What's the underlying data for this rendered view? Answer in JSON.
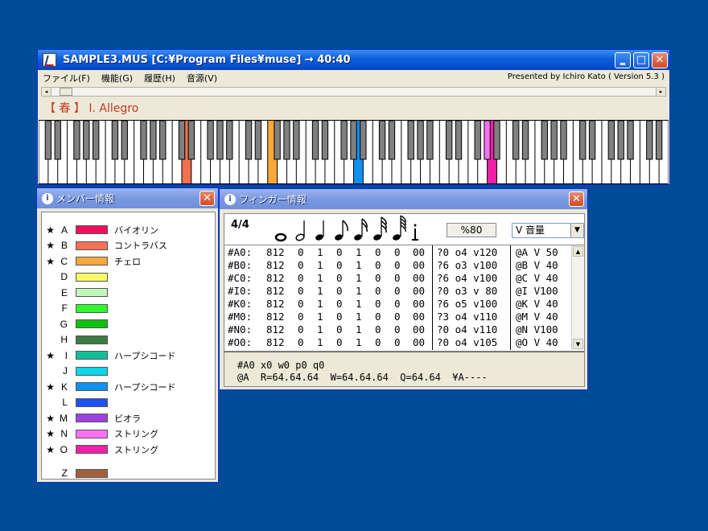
{
  "main_window": {
    "title": "SAMPLE3.MUS [C:¥Program Files¥muse] → 40:40",
    "menu": [
      "ファイル(F)",
      "機能(G)",
      "履歴(H)",
      "音源(V)"
    ],
    "presented": "Presented by Ichiro Kato ( Version 5.3 )",
    "piece_title": "【 春 】 Ⅰ. Allegro"
  },
  "keyboard": {
    "highlight_colors": {
      "salmon": "#f07050",
      "orange": "#f8a838",
      "blue": "#1090f0",
      "pink": "#f870f0",
      "magenta": "#f020a8"
    }
  },
  "member_window": {
    "title": "メンバー情報",
    "members": [
      {
        "star": "★",
        "letter": "A",
        "color": "#f0105a",
        "name": "バイオリン"
      },
      {
        "star": "★",
        "letter": "B",
        "color": "#f87058",
        "name": "コントラバス"
      },
      {
        "star": "★",
        "letter": "C",
        "color": "#f8a840",
        "name": "チェロ"
      },
      {
        "star": "",
        "letter": "D",
        "color": "#f8f868",
        "name": ""
      },
      {
        "star": "",
        "letter": "E",
        "color": "#c0f8b8",
        "name": ""
      },
      {
        "star": "",
        "letter": "F",
        "color": "#30f830",
        "name": ""
      },
      {
        "star": "",
        "letter": "G",
        "color": "#10c010",
        "name": ""
      },
      {
        "star": "",
        "letter": "H",
        "color": "#3c7c40",
        "name": ""
      },
      {
        "star": "★",
        "letter": "I",
        "color": "#10c098",
        "name": "ハープシコード"
      },
      {
        "star": "",
        "letter": "J",
        "color": "#08d8e8",
        "name": ""
      },
      {
        "star": "★",
        "letter": "K",
        "color": "#1090f0",
        "name": "ハープシコード"
      },
      {
        "star": "",
        "letter": "L",
        "color": "#2050f0",
        "name": ""
      },
      {
        "star": "★",
        "letter": "M",
        "color": "#a040e0",
        "name": "ビオラ"
      },
      {
        "star": "★",
        "letter": "N",
        "color": "#f870f0",
        "name": "ストリング"
      },
      {
        "star": "★",
        "letter": "O",
        "color": "#f020a8",
        "name": "ストリング"
      },
      {
        "star": "",
        "letter": "Z",
        "color": "#a06040",
        "name": ""
      }
    ]
  },
  "finger_window": {
    "title": "フィンガー情報",
    "meter": "4/4",
    "percent": "%80",
    "volume_select": "V 音量",
    "rows": [
      {
        "ch": "#A0:",
        "v1": "812",
        "n": [
          "0",
          "1",
          "0",
          "1",
          "0",
          "0"
        ],
        "code": "00",
        "p": "?0 o4 v120",
        "at": "@A V 50"
      },
      {
        "ch": "#B0:",
        "v1": "812",
        "n": [
          "0",
          "1",
          "0",
          "1",
          "0",
          "0"
        ],
        "code": "00",
        "p": "?6 o3 v100",
        "at": "@B V 40"
      },
      {
        "ch": "#C0:",
        "v1": "812",
        "n": [
          "0",
          "1",
          "0",
          "1",
          "0",
          "0"
        ],
        "code": "00",
        "p": "?6 o4 v100",
        "at": "@C V 40"
      },
      {
        "ch": "#I0:",
        "v1": "812",
        "n": [
          "0",
          "1",
          "0",
          "1",
          "0",
          "0"
        ],
        "code": "00",
        "p": "?0 o3 v 80",
        "at": "@I V100"
      },
      {
        "ch": "#K0:",
        "v1": "812",
        "n": [
          "0",
          "1",
          "0",
          "1",
          "0",
          "0"
        ],
        "code": "00",
        "p": "?6 o5 v100",
        "at": "@K V 40"
      },
      {
        "ch": "#M0:",
        "v1": "812",
        "n": [
          "0",
          "1",
          "0",
          "1",
          "0",
          "0"
        ],
        "code": "00",
        "p": "?3 o4 v110",
        "at": "@M V 40"
      },
      {
        "ch": "#N0:",
        "v1": "812",
        "n": [
          "0",
          "1",
          "0",
          "1",
          "0",
          "0"
        ],
        "code": "00",
        "p": "?0 o4 v110",
        "at": "@N V100"
      },
      {
        "ch": "#O0:",
        "v1": "812",
        "n": [
          "0",
          "1",
          "0",
          "1",
          "0",
          "0"
        ],
        "code": "00",
        "p": "?0 o4 v105",
        "at": "@O V 40"
      }
    ],
    "footer_line1": "#A0 x0 w0 p0 q0",
    "footer_line2": "@A  R=64.64.64  W=64.64.64  Q=64.64  ¥A----"
  }
}
